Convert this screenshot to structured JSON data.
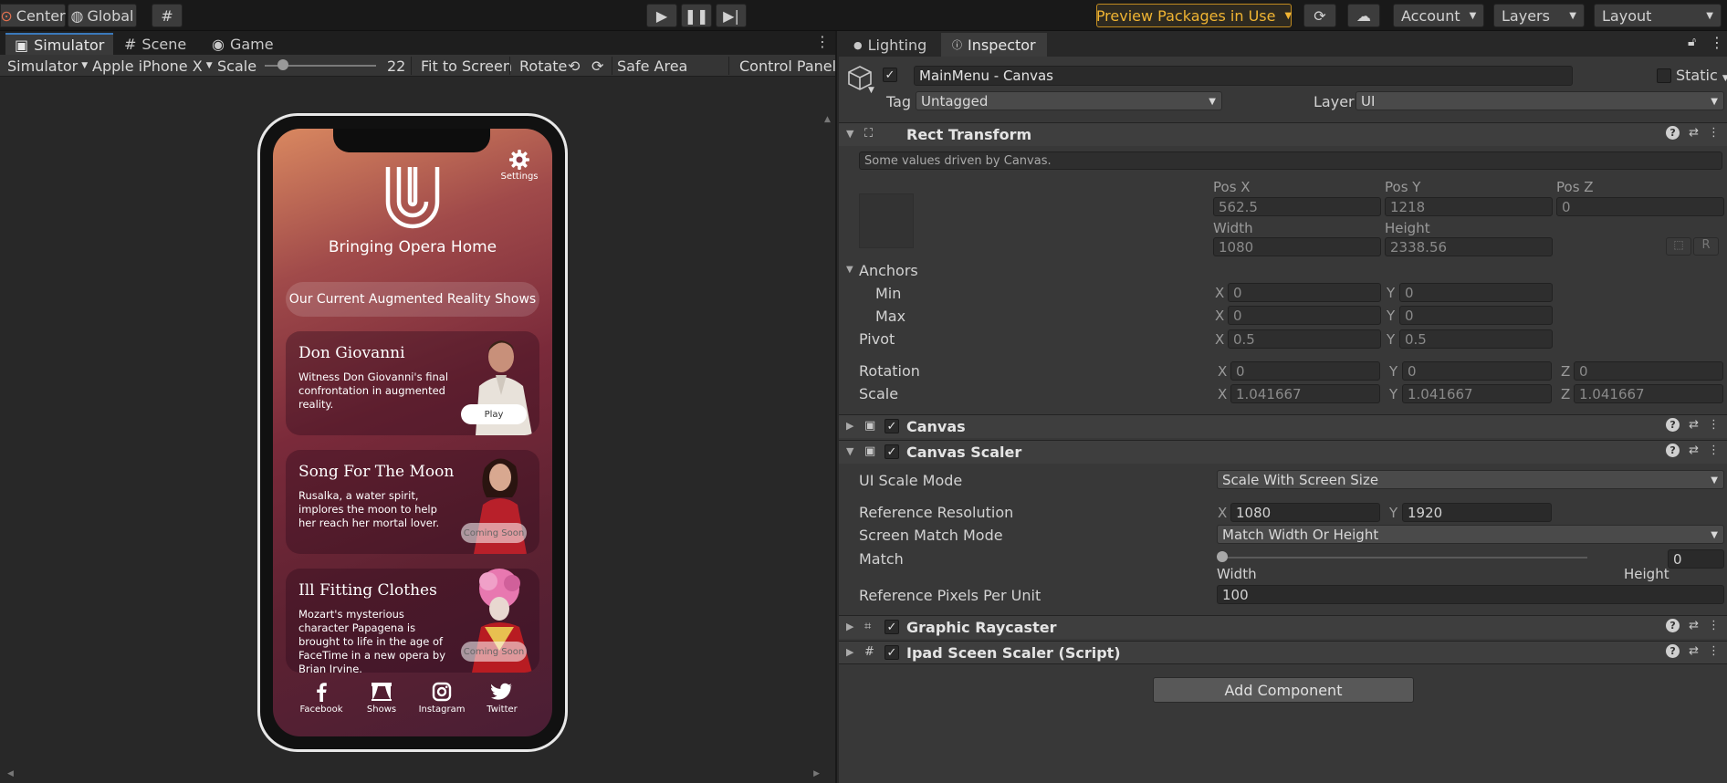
{
  "toolbar": {
    "center": "Center",
    "global": "Global",
    "preview_packages": "Preview Packages in Use",
    "account": "Account",
    "layers": "Layers",
    "layout": "Layout"
  },
  "left_tabs": [
    "Simulator",
    "Scene",
    "Game"
  ],
  "sim_toolbar": {
    "simulator": "Simulator",
    "device": "Apple iPhone X",
    "scale_label": "Scale",
    "scale_value": "22",
    "fit": "Fit to Screen",
    "rotate": "Rotate",
    "safe_area": "Safe Area",
    "control_panel": "Control Panel"
  },
  "app": {
    "settings": "Settings",
    "brand": "Bringing Opera Home",
    "header": "Our Current Augmented Reality Shows",
    "cards": [
      {
        "title": "Don Giovanni",
        "desc": "Witness Don Giovanni's final confrontation in augmented reality.",
        "button": "Play"
      },
      {
        "title": "Song For The Moon",
        "desc": "Rusalka, a water spirit, implores the moon to help her reach her mortal lover.",
        "button": "Coming Soon"
      },
      {
        "title": "Ill Fitting Clothes",
        "desc": "Mozart's mysterious character Papagena is brought to life in the age of FaceTime in a new opera by Brian Irvine.",
        "button": "Coming Soon"
      }
    ],
    "nav": [
      "Facebook",
      "Shows",
      "Instagram",
      "Twitter"
    ]
  },
  "inspector": {
    "tabs": [
      "Lighting",
      "Inspector"
    ],
    "object_name": "MainMenu - Canvas",
    "static": "Static",
    "tag_label": "Tag",
    "tag_value": "Untagged",
    "layer_label": "Layer",
    "layer_value": "UI",
    "rect_transform": {
      "title": "Rect Transform",
      "note": "Some values driven by Canvas.",
      "pos_x_label": "Pos X",
      "pos_y_label": "Pos Y",
      "pos_z_label": "Pos Z",
      "pos_x": "562.5",
      "pos_y": "1218",
      "pos_z": "0",
      "width_label": "Width",
      "height_label": "Height",
      "width": "1080",
      "height": "2338.56",
      "anchors": "Anchors",
      "min": "Min",
      "max": "Max",
      "min_x": "0",
      "min_y": "0",
      "max_x": "0",
      "max_y": "0",
      "pivot": "Pivot",
      "pivot_x": "0.5",
      "pivot_y": "0.5",
      "rotation": "Rotation",
      "rot_x": "0",
      "rot_y": "0",
      "rot_z": "0",
      "scale": "Scale",
      "scale_x": "1.041667",
      "scale_y": "1.041667",
      "scale_z": "1.041667",
      "x": "X",
      "y": "Y",
      "z": "Z",
      "r": "R"
    },
    "canvas": "Canvas",
    "canvas_scaler": {
      "title": "Canvas Scaler",
      "ui_scale_mode": "UI Scale Mode",
      "ui_scale_mode_value": "Scale With Screen Size",
      "ref_res": "Reference Resolution",
      "ref_x": "1080",
      "ref_y": "1920",
      "match_mode": "Screen Match Mode",
      "match_mode_value": "Match Width Or Height",
      "match": "Match",
      "match_value": "0",
      "match_level": 0,
      "width": "Width",
      "height": "Height",
      "ppu": "Reference Pixels Per Unit",
      "ppu_value": "100"
    },
    "graphic_raycaster": "Graphic Raycaster",
    "ipad_scaler": "Ipad Sceen Scaler (Script)",
    "add_component": "Add Component"
  }
}
